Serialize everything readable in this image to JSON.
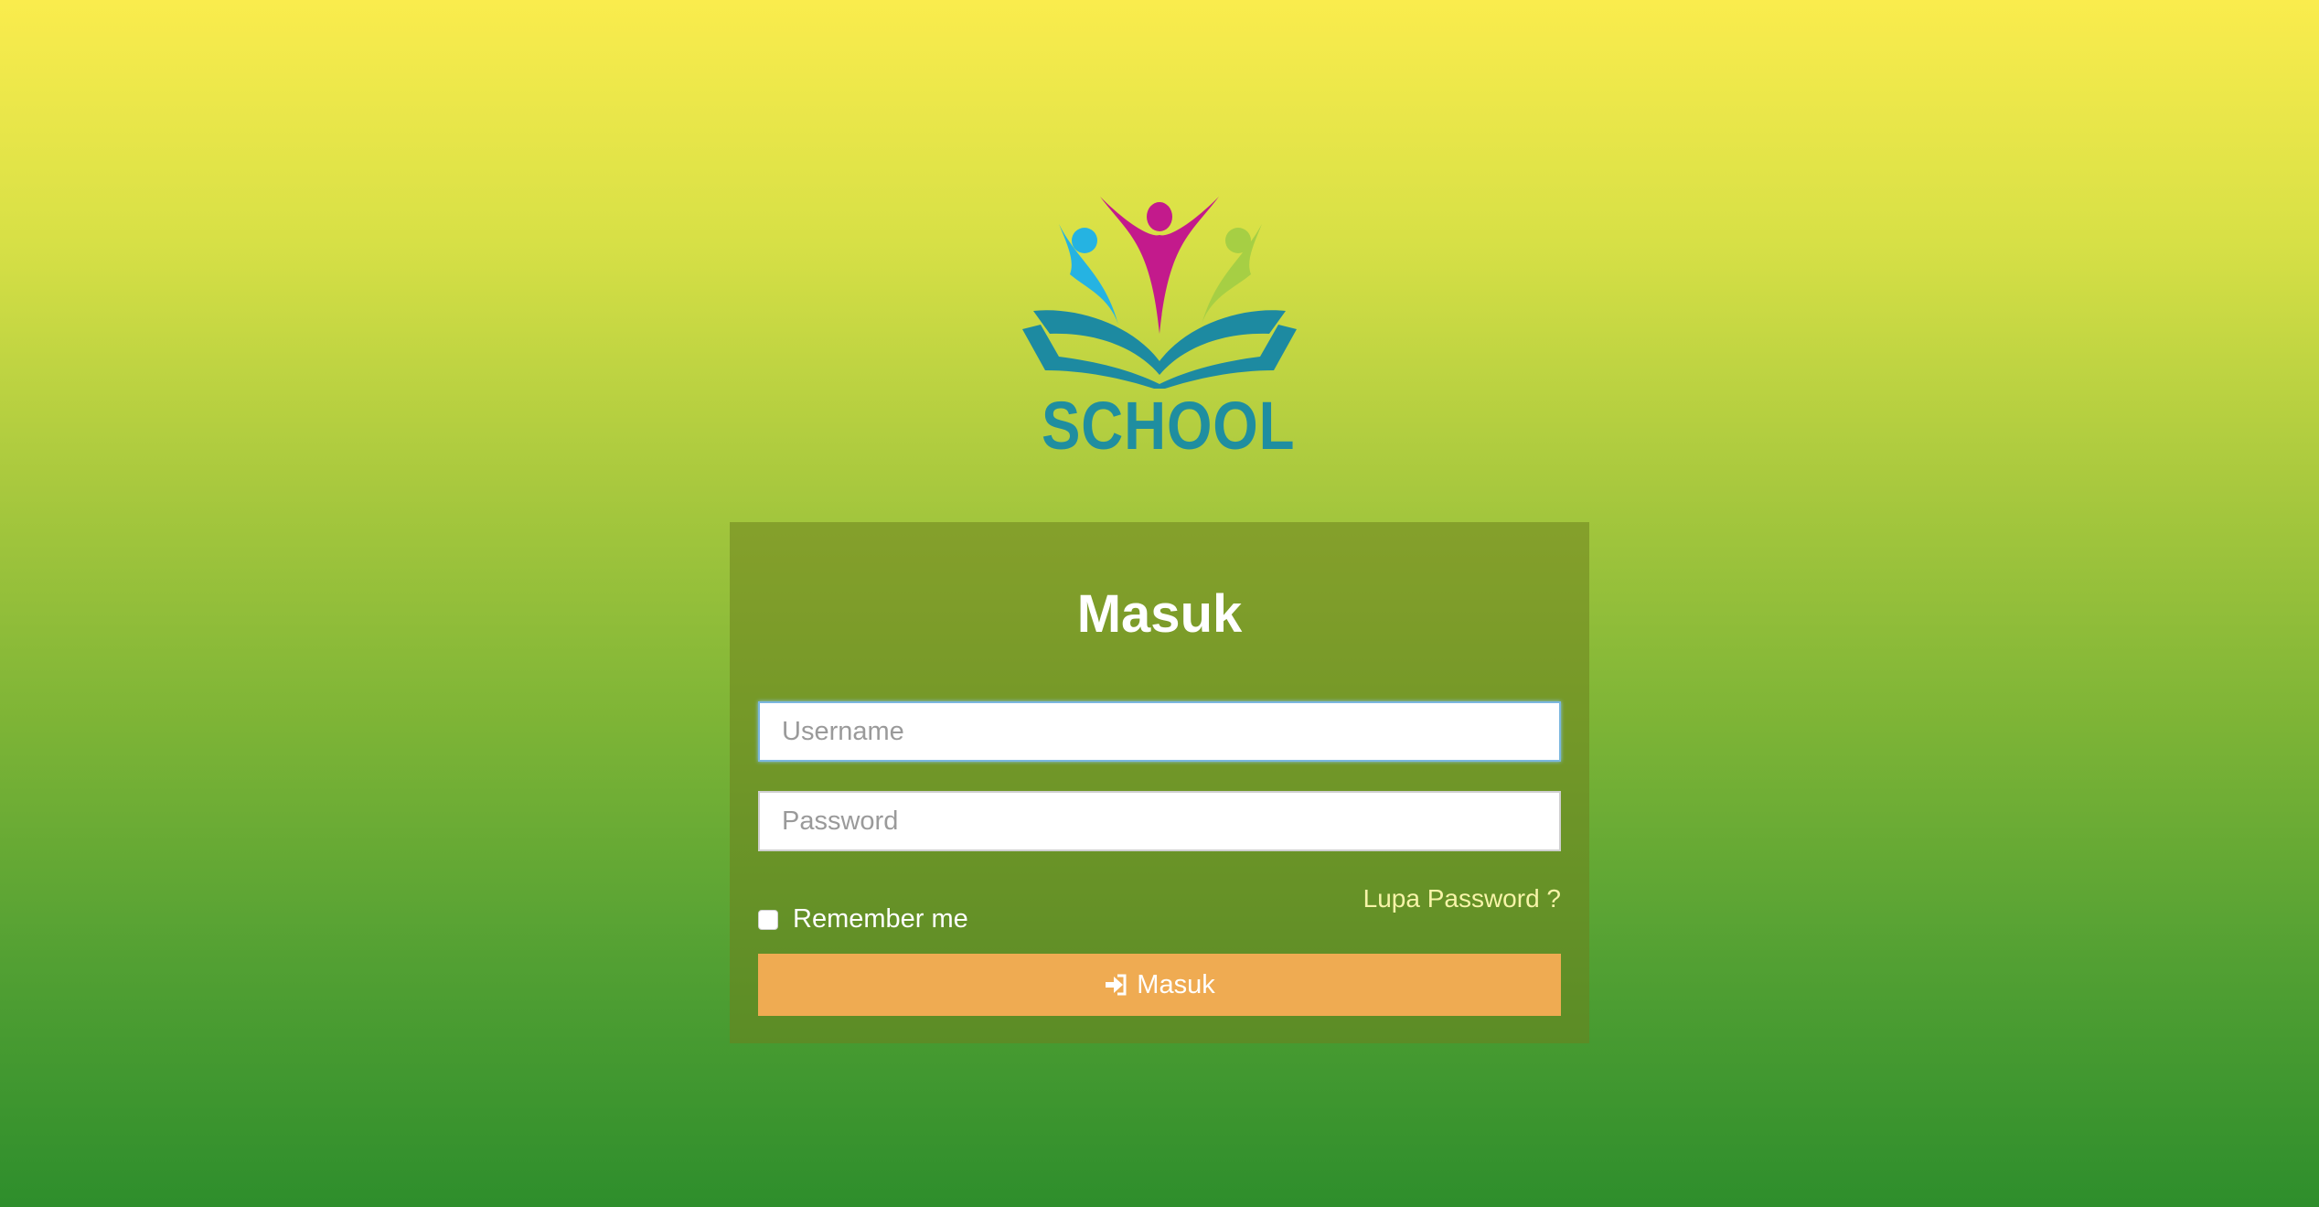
{
  "logo": {
    "text": "SCHOOL",
    "icon": "school-book-people-logo",
    "colors": {
      "magenta": "#c31a8c",
      "cyan": "#25b3e2",
      "lime": "#a6cf44",
      "teal": "#1d8aa1"
    }
  },
  "login": {
    "title": "Masuk",
    "username_placeholder": "Username",
    "password_placeholder": "Password",
    "remember_label": "Remember me",
    "forgot_link": "Lupa Password ?",
    "submit_label": "Masuk",
    "submit_icon": "sign-in-icon"
  },
  "colors": {
    "background_top": "#faec4d",
    "background_bottom": "#2e8e2c",
    "button": "#efab52",
    "link": "#f7f4a8"
  }
}
